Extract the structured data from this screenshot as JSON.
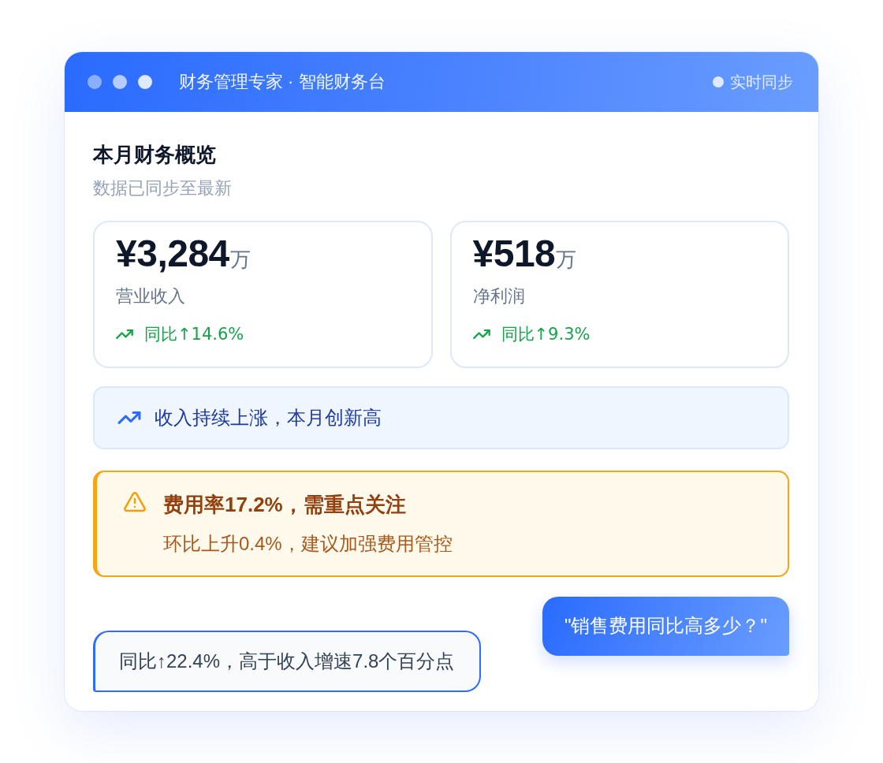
{
  "window": {
    "title": "财务管理专家 · 智能财务台",
    "sync_label": "实时同步"
  },
  "overview": {
    "title": "本月财务概览",
    "subtitle": "数据已同步至最新"
  },
  "metrics": [
    {
      "value": "¥3,284",
      "unit": "万",
      "label": "营业收入",
      "change": "同比↑14.6%"
    },
    {
      "value": "¥518",
      "unit": "万",
      "label": "净利润",
      "change": "同比↑9.3%"
    }
  ],
  "insight": {
    "text": "收入持续上涨，本月创新高"
  },
  "alert": {
    "title": "费用率17.2%，需重点关注",
    "message": "环比上升0.4%，建议加强费用管控"
  },
  "messages": [
    {
      "kind": "user",
      "text": "\"销售费用同比高多少？\""
    },
    {
      "kind": "reply",
      "text": "同比↑22.4%，高于收入增速7.8个百分点"
    }
  ]
}
